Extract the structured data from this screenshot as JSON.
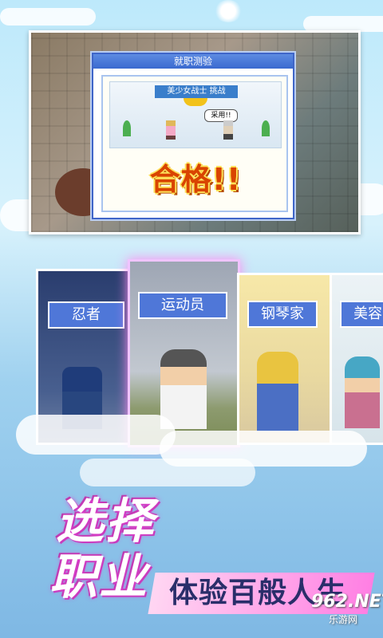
{
  "screen": {
    "dialog_title": "就职测验",
    "challenge_banner": "美少女战士   挑战",
    "speech_bubble": "采用!!",
    "result_text": "合格!!"
  },
  "cards": [
    {
      "label": "忍者"
    },
    {
      "label": "运动员"
    },
    {
      "label": "钢琴家"
    },
    {
      "label": "美容"
    }
  ],
  "headline": {
    "line1": "选择",
    "line2": "职业",
    "slogan": "体验百般人生"
  },
  "watermark": {
    "number": "962",
    "suffix": ".NET",
    "sub": "乐游网"
  },
  "colors": {
    "label_blue": "#4f77d8",
    "headline_pink": "#e23fd0",
    "result_orange": "#d94400"
  }
}
